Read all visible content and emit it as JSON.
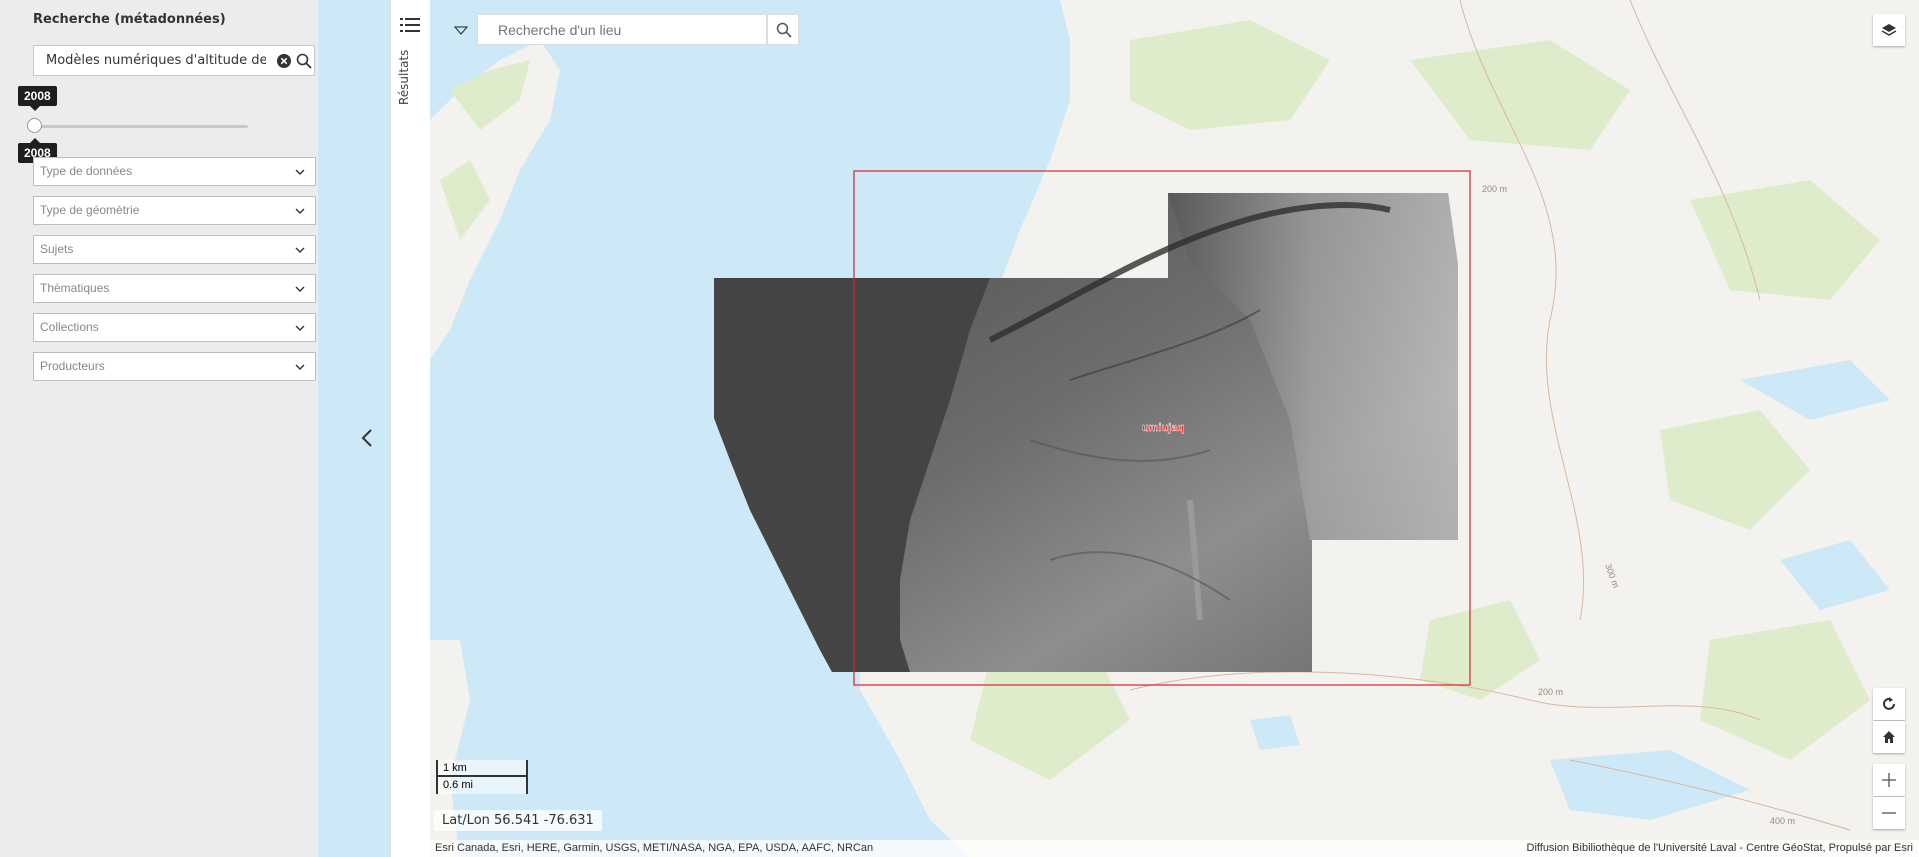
{
  "sidebar": {
    "title": "Recherche (métadonnées)",
    "search_value": "Modèles numériques d'altitude des vill",
    "slider_top_label": "2008",
    "slider_bottom_label": "2008",
    "filters": [
      "Type de données",
      "Type de géomètrie",
      "Sujets",
      "Thèmatiques",
      "Collections",
      "Producteurs"
    ]
  },
  "results_panel": {
    "label": "Résultats"
  },
  "map": {
    "place_search_placeholder": "Recherche d'un lieu",
    "feature_label": "umiujaq",
    "contour_labels": [
      "200 m",
      "300 m",
      "200 m",
      "400 m"
    ],
    "scale_km": "1 km",
    "scale_mi": "0.6 mi",
    "coordinates": "Lat/Lon 56.541 -76.631",
    "attribution_left": "Esri Canada, Esri, HERE, Garmin, USGS, METI/NASA, NGA, EPA, USDA, AAFC, NRCan",
    "attribution_right": "Diffusion Bibiliothèque de l'Université Laval - Centre GéoStat, Propulsé par Esri"
  },
  "colors": {
    "water": "#cde8f7",
    "land": "#f3f2ee",
    "vegetation": "#dfeccb",
    "extent_outline": "#d9232d"
  }
}
